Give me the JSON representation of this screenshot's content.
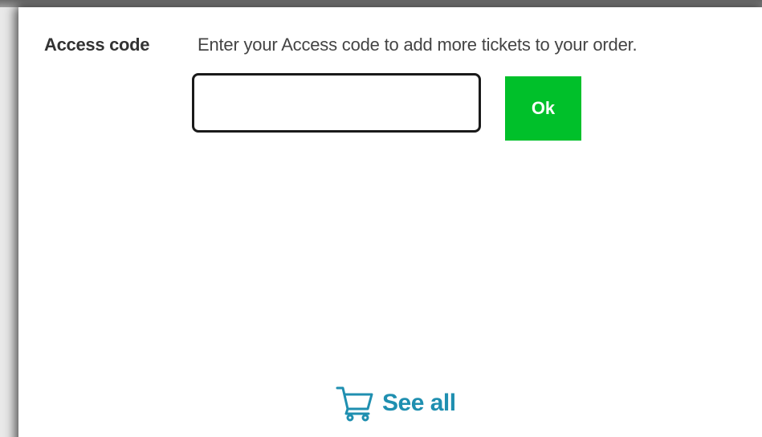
{
  "access_code": {
    "label": "Access code",
    "hint": "Enter your Access code to add more tickets to your order.",
    "input_value": "",
    "input_placeholder": "",
    "ok_label": "Ok"
  },
  "footer": {
    "see_all_label": "See all",
    "icon": "shopping-cart-icon"
  },
  "colors": {
    "ok_button": "#00c02a",
    "link": "#1f8fb0",
    "input_border": "#1a1a1a"
  }
}
